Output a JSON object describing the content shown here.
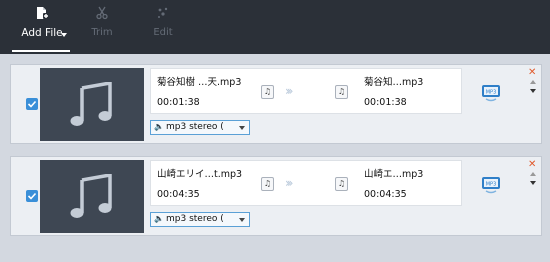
{
  "toolbar": {
    "add_file": {
      "label": "Add File",
      "icon": "add-file-icon"
    },
    "trim": {
      "label": "Trim",
      "icon": "scissors-icon"
    },
    "edit": {
      "label": "Edit",
      "icon": "effects-icon"
    }
  },
  "files": [
    {
      "source_name": "菊谷知樹 …天.mp3",
      "source_duration": "00:01:38",
      "output_name": "菊谷知…mp3",
      "output_duration": "00:01:38",
      "format": "mp3 stereo (",
      "checked": true
    },
    {
      "source_name": "山崎エリイ…t.mp3",
      "source_duration": "00:04:35",
      "output_name": "山崎エ…mp3",
      "output_duration": "00:04:35",
      "format": "mp3 stereo (",
      "checked": true
    }
  ],
  "colors": {
    "toolbar_bg": "#2b3038",
    "accent": "#3a8fd8",
    "close": "#e05a2c"
  }
}
